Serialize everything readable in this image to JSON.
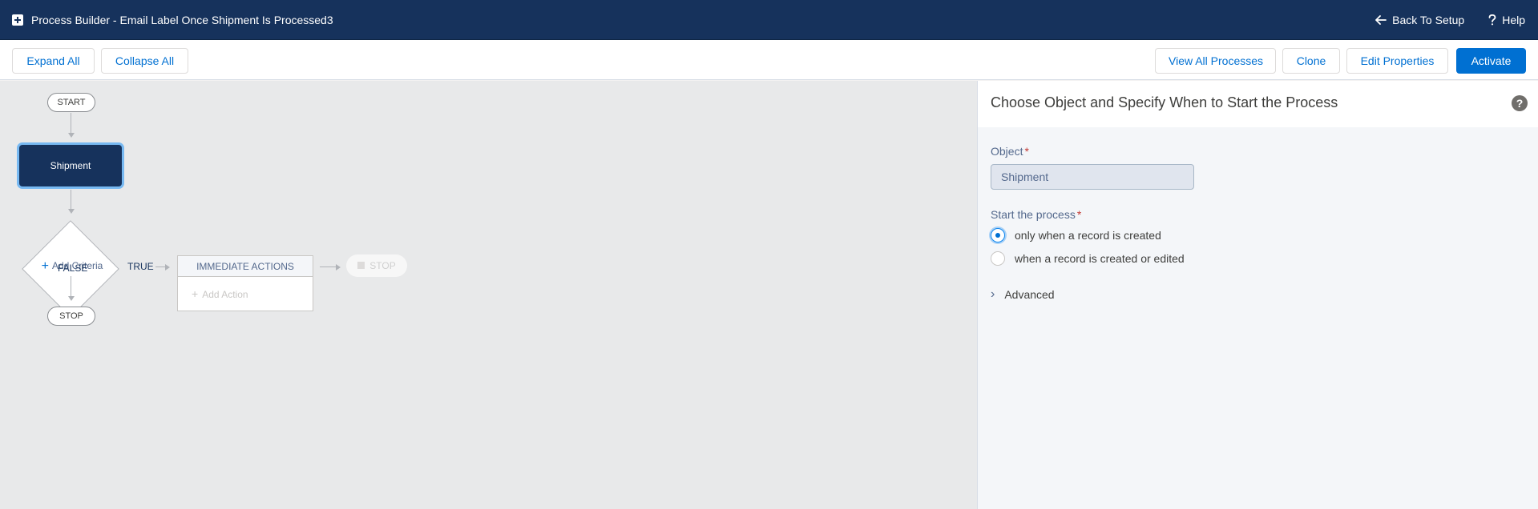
{
  "header": {
    "title": "Process Builder - Email Label Once Shipment Is Processed3",
    "back_label": "Back To Setup",
    "help_label": "Help"
  },
  "toolbar": {
    "expand_all": "Expand All",
    "collapse_all": "Collapse All",
    "view_all": "View All Processes",
    "clone": "Clone",
    "edit_properties": "Edit Properties",
    "activate": "Activate"
  },
  "canvas": {
    "start_label": "START",
    "object_node": "Shipment",
    "criteria_label": "Add Criteria",
    "true_label": "TRUE",
    "false_label": "FALSE",
    "immediate_actions": "IMMEDIATE ACTIONS",
    "add_action": "Add Action",
    "stop_faded": "STOP",
    "stop_label": "STOP"
  },
  "panel": {
    "title": "Choose Object and Specify When to Start the Process",
    "object_label": "Object",
    "object_value": "Shipment",
    "start_label": "Start the process",
    "options": [
      {
        "label": "only when a record is created",
        "selected": true
      },
      {
        "label": "when a record is created or edited",
        "selected": false
      }
    ],
    "advanced": "Advanced"
  },
  "colors": {
    "header_bg": "#16325c",
    "brand": "#0070d2",
    "required": "#c23934"
  }
}
